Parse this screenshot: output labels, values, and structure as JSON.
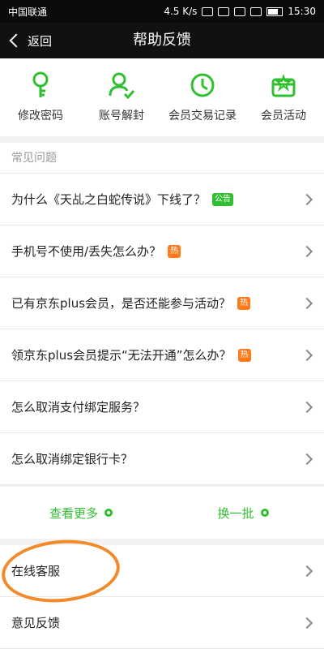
{
  "status": {
    "carrier": "中国联通",
    "speed": "4.5 K/s",
    "time": "15:30"
  },
  "header": {
    "back_label": "返回",
    "title": "帮助反馈"
  },
  "quick": [
    {
      "label": "修改密码",
      "icon": "key-icon"
    },
    {
      "label": "账号解封",
      "icon": "user-check-icon"
    },
    {
      "label": "会员交易记录",
      "icon": "clock-icon"
    },
    {
      "label": "会员活动",
      "icon": "gift-icon"
    }
  ],
  "faq": {
    "header": "常见问题",
    "items": [
      {
        "text": "为什么《天乩之白蛇传说》下线了？",
        "badge": "公告",
        "badge_color": "green"
      },
      {
        "text": "手机号不使用/丢失怎么办？",
        "badge": "热",
        "badge_color": "orange"
      },
      {
        "text": "已有京东plus会员，是否还能参与活动？",
        "badge": "热",
        "badge_color": "orange"
      },
      {
        "text": "领京东plus会员提示“无法开通”怎么办？",
        "badge": "热",
        "badge_color": "orange"
      },
      {
        "text": "怎么取消支付绑定服务？",
        "badge": "",
        "badge_color": ""
      },
      {
        "text": "怎么取消绑定银行卡？",
        "badge": "",
        "badge_color": ""
      }
    ]
  },
  "actions": {
    "more": "查看更多",
    "refresh": "换一批"
  },
  "support": {
    "online": "在线客服",
    "feedback": "意见反馈"
  },
  "colors": {
    "accent": "#2fbf2f",
    "hot": "#ff7a1a",
    "annotation": "#f28a2a",
    "topbar": "#111111"
  }
}
